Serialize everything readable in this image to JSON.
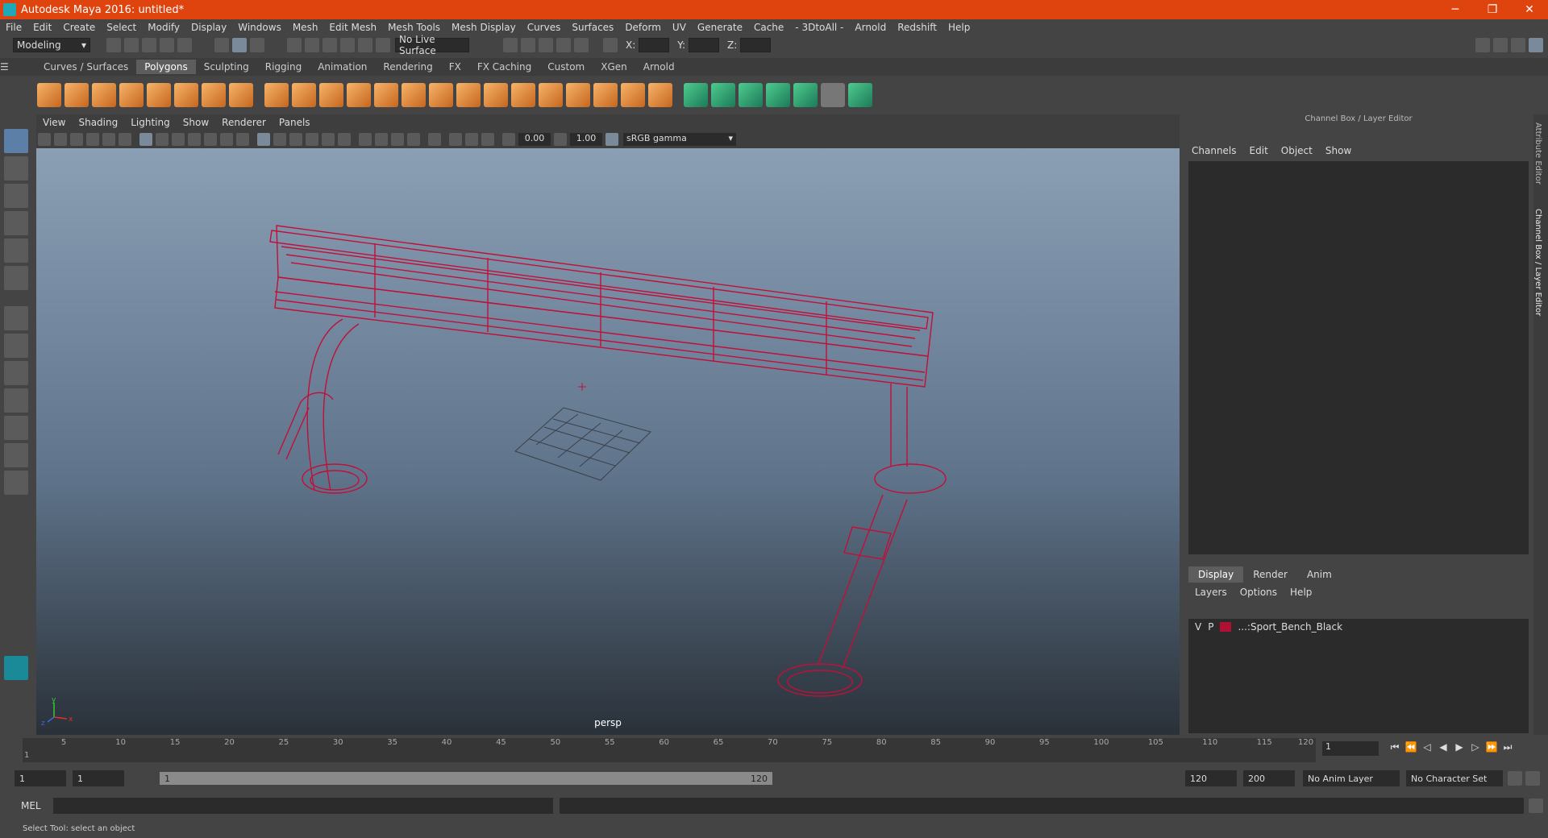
{
  "window": {
    "title": "Autodesk Maya 2016: untitled*"
  },
  "menubar": [
    "File",
    "Edit",
    "Create",
    "Select",
    "Modify",
    "Display",
    "Windows",
    "Mesh",
    "Edit Mesh",
    "Mesh Tools",
    "Mesh Display",
    "Curves",
    "Surfaces",
    "Deform",
    "UV",
    "Generate",
    "Cache",
    "- 3DtoAll -",
    "Arnold",
    "Redshift",
    "Help"
  ],
  "status": {
    "mode": "Modeling",
    "live_surface": "No Live Surface",
    "x": "X:",
    "y": "Y:",
    "z": "Z:"
  },
  "shelf_tabs": [
    "Curves / Surfaces",
    "Polygons",
    "Sculpting",
    "Rigging",
    "Animation",
    "Rendering",
    "FX",
    "FX Caching",
    "Custom",
    "XGen",
    "Arnold"
  ],
  "shelf_active": "Polygons",
  "viewport": {
    "menu": [
      "View",
      "Shading",
      "Lighting",
      "Show",
      "Renderer",
      "Panels"
    ],
    "exposure": "0.00",
    "gamma": "1.00",
    "color_space": "sRGB gamma",
    "camera": "persp",
    "axis_x": "x",
    "axis_y": "y",
    "axis_z": "z"
  },
  "channel_box": {
    "title": "Channel Box / Layer Editor",
    "menu": [
      "Channels",
      "Edit",
      "Object",
      "Show"
    ]
  },
  "layer_editor": {
    "tabs": [
      "Display",
      "Render",
      "Anim"
    ],
    "active_tab": "Display",
    "menu": [
      "Layers",
      "Options",
      "Help"
    ],
    "layer": {
      "v": "V",
      "p": "P",
      "name": "...:Sport_Bench_Black",
      "color": "#b01034"
    }
  },
  "sidebar": {
    "attribute_editor": "Attribute Editor",
    "channel_box": "Channel Box / Layer Editor"
  },
  "timeline": {
    "ticks": [
      "5",
      "10",
      "15",
      "20",
      "25",
      "30",
      "35",
      "40",
      "45",
      "50",
      "55",
      "60",
      "65",
      "70",
      "75",
      "80",
      "85",
      "90",
      "95",
      "100",
      "105",
      "110",
      "115",
      "120"
    ],
    "start_label": "1",
    "current_frame": "1"
  },
  "range": {
    "start": "1",
    "playback_start": "1",
    "slider_start": "1",
    "slider_end": "120",
    "playback_end": "120",
    "end": "200",
    "anim_layer": "No Anim Layer",
    "char_set": "No Character Set"
  },
  "cmdline": {
    "lang": "MEL"
  },
  "helpline": {
    "text": "Select Tool: select an object"
  },
  "colors": {
    "wireframe": "#c0103a",
    "titlebar": "#e0440e"
  }
}
